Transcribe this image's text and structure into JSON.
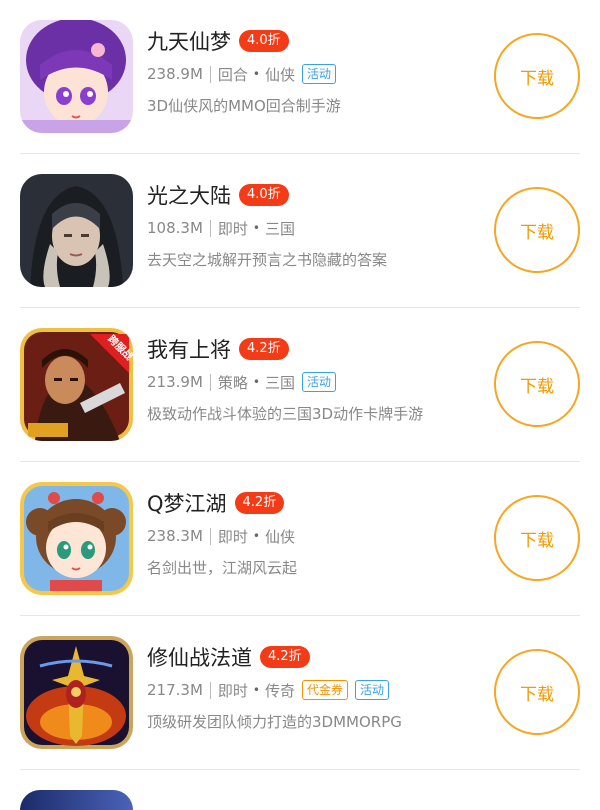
{
  "apps": [
    {
      "name": "九天仙梦",
      "discount": "4.0折",
      "size": "238.9M",
      "type": "回合",
      "genre": "仙侠",
      "tags": [
        {
          "text": "活动",
          "color": "blue"
        }
      ],
      "desc": "3D仙侠风的MMO回合制手游",
      "download": "下载",
      "icon": "anime-girl-purple-hair-icon"
    },
    {
      "name": "光之大陆",
      "discount": "4.0折",
      "size": "108.3M",
      "type": "即时",
      "genre": "三国",
      "tags": [],
      "desc": "去天空之城解开预言之书隐藏的答案",
      "download": "下载",
      "icon": "hooded-warrior-icon"
    },
    {
      "name": "我有上将",
      "discount": "4.2折",
      "size": "213.9M",
      "type": "策略",
      "genre": "三国",
      "tags": [
        {
          "text": "活动",
          "color": "blue"
        }
      ],
      "desc": "极致动作战斗体验的三国3D动作卡牌手游",
      "download": "下载",
      "icon": "three-kingdoms-general-icon",
      "icon_banner": "跨服战"
    },
    {
      "name": "Q梦江湖",
      "discount": "4.2折",
      "size": "238.3M",
      "type": "即时",
      "genre": "仙侠",
      "tags": [],
      "desc": "名剑出世，江湖风云起",
      "download": "下载",
      "icon": "chibi-girl-icon"
    },
    {
      "name": "修仙战法道",
      "discount": "4.2折",
      "size": "217.3M",
      "type": "即时",
      "genre": "传奇",
      "tags": [
        {
          "text": "代金券",
          "color": "orange"
        },
        {
          "text": "活动",
          "color": "blue"
        }
      ],
      "desc": "顶级研发团队倾力打造的3DMMORPG",
      "download": "下载",
      "icon": "golden-sword-emblem-icon"
    }
  ],
  "colors": {
    "discount_bg": "#f33b17",
    "download_border": "#f5a623",
    "tag_blue": "#3aa0e8",
    "tag_orange": "#f29200"
  }
}
